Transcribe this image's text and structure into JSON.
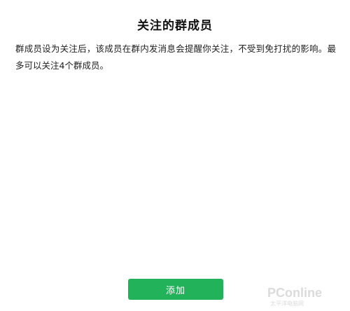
{
  "header": {
    "title": "关注的群成员"
  },
  "main": {
    "description": "群成员设为关注后，该成员在群内发消息会提醒你关注，不受到免打扰的影响。最多可以关注4个群成员。"
  },
  "actions": {
    "add_label": "添加"
  },
  "watermark": {
    "brand": "PConline",
    "subtitle": "太平洋电脑网"
  },
  "colors": {
    "accent": "#22b35a",
    "background": "#ffffff",
    "text": "#111111"
  }
}
